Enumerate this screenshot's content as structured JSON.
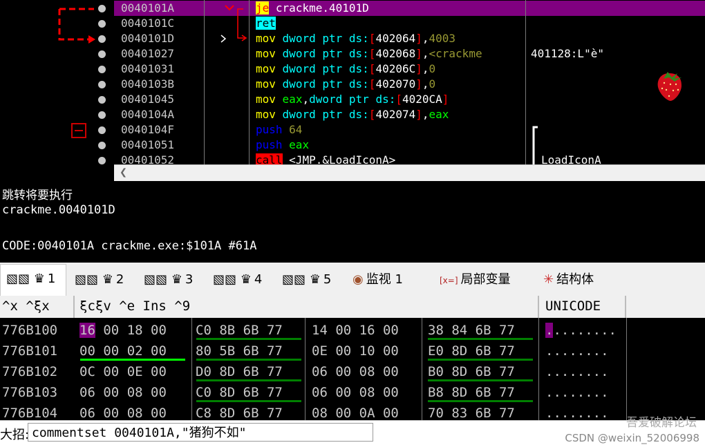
{
  "disasm": {
    "addresses": [
      "0040101A",
      "0040101C",
      "0040101D",
      "00401027",
      "00401031",
      "0040103B",
      "00401045",
      "0040104A",
      "0040104F",
      "00401051",
      "00401052"
    ],
    "comment_row3": "401128:L\"è\"",
    "comment_row10": "LoadIconA",
    "instr": {
      "r0_mn": "je",
      "r0_op": "crackme.40101D",
      "r1_mn": "ret",
      "r2_mn": "mov",
      "r2_sz": "dword ptr",
      "r2_seg": "ds:",
      "r2_addr": "402064",
      "r2_imm": "4003",
      "r3_mn": "mov",
      "r3_sz": "dword ptr",
      "r3_seg": "ds:",
      "r3_addr": "402068",
      "r3_lbl": "<crackme",
      "r4_mn": "mov",
      "r4_sz": "dword ptr",
      "r4_seg": "ds:",
      "r4_addr": "40206C",
      "r4_imm": "0",
      "r5_mn": "mov",
      "r5_sz": "dword ptr",
      "r5_seg": "ds:",
      "r5_addr": "402070",
      "r5_imm": "0",
      "r6_mn": "mov",
      "r6_reg": "eax",
      "r6_sz": "dword ptr",
      "r6_seg": "ds:",
      "r6_addr": "4020CA",
      "r7_mn": "mov",
      "r7_sz": "dword ptr",
      "r7_seg": "ds:",
      "r7_addr": "402074",
      "r7_reg": "eax",
      "r8_mn": "push",
      "r8_imm": "64",
      "r9_mn": "push",
      "r9_reg": "eax",
      "r10_mn": "call",
      "r10_op": "<JMP.&LoadIconA>"
    }
  },
  "info": {
    "line1": "跳转将要执行",
    "line2": "crackme.0040101D",
    "line3": "CODE:0040101A crackme.exe:$101A #61A"
  },
  "tabs": [
    {
      "label": "1",
      "icon": "memory-icon"
    },
    {
      "label": "2",
      "icon": "memory-icon"
    },
    {
      "label": "3",
      "icon": "memory-icon"
    },
    {
      "label": "4",
      "icon": "memory-icon"
    },
    {
      "label": "5",
      "icon": "memory-icon"
    },
    {
      "label": "监视 1",
      "icon": "watch-icon"
    },
    {
      "label": "局部变量",
      "icon": "locals-icon"
    },
    {
      "label": "结构体",
      "icon": "struct-icon"
    }
  ],
  "dump": {
    "headers": {
      "address": "^x ^ξx",
      "hex": "ξcξv ^e Ins ^9",
      "unicode": "UNICODE"
    },
    "rows": [
      {
        "addr": "776B100",
        "g1": [
          "16",
          "00",
          "18",
          "00"
        ],
        "g2": "C0 8B 6B 77",
        "g3": "14 00 16 00",
        "g4": "38 84 6B 77",
        "uni": "........"
      },
      {
        "addr": "776B101",
        "g1": [
          "00",
          "00",
          "02",
          "00"
        ],
        "g2": "80 5B 6B 77",
        "g3": "0E 00 10 00",
        "g4": "E0 8D 6B 77",
        "uni": "........"
      },
      {
        "addr": "776B102",
        "g1": [
          "0C",
          "00",
          "0E",
          "00"
        ],
        "g2": "D0 8D 6B 77",
        "g3": "06 00 08 00",
        "g4": "B0 8D 6B 77",
        "uni": "........"
      },
      {
        "addr": "776B103",
        "g1": [
          "06",
          "00",
          "08",
          "00"
        ],
        "g2": "C0 8D 6B 77",
        "g3": "06 00 08 00",
        "g4": "B8 8D 6B 77",
        "uni": "........"
      },
      {
        "addr": "776B104",
        "g1": [
          "06",
          "00",
          "08",
          "00"
        ],
        "g2": "C8 8D 6B 77",
        "g3": "08 00 0A 00",
        "g4": "70 83 6B 77",
        "uni": "........"
      }
    ]
  },
  "command": {
    "label": "大招:",
    "value": "commentset 0040101A,\"猪狗不如\""
  },
  "watermark": "CSDN @weixin_52006998",
  "watermark2": "吾爱破解论坛",
  "colors": {
    "selection": "#800080",
    "jump": "#ffff00",
    "background": "#000000"
  }
}
